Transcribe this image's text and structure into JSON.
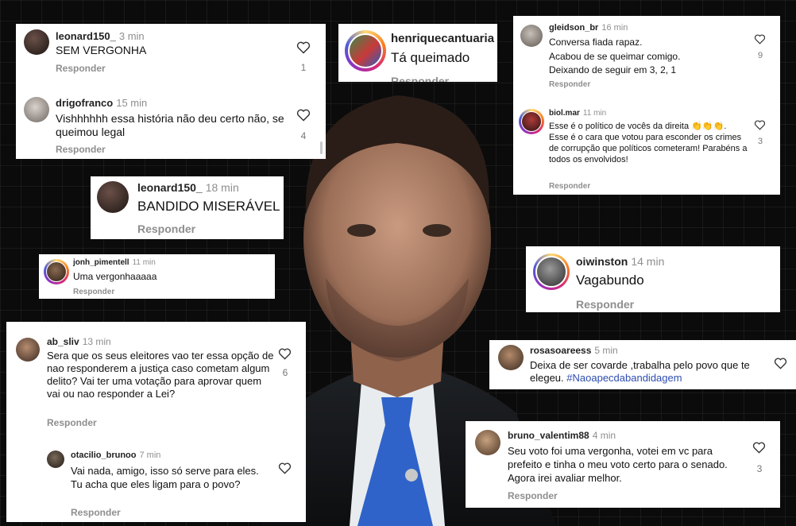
{
  "comments": {
    "c1": {
      "user": "leonard150_",
      "time": "3 min",
      "text": "SEM VERGONHA",
      "reply": "Responder",
      "likes": "1"
    },
    "c2": {
      "user": "drigofranco",
      "time": "15 min",
      "text": "Vishhhhhh essa história não deu certo não, se queimou legal",
      "reply": "Responder",
      "likes": "4"
    },
    "c3": {
      "user": "henriquecantuaria",
      "text": "Tá queimado",
      "reply": "Responder"
    },
    "c4": {
      "user": "gleidson_br",
      "time": "16 min",
      "lines": [
        "Conversa fiada rapaz.",
        "Acabou de se queimar comigo.",
        "Deixando de seguir em 3, 2, 1"
      ],
      "reply": "Responder",
      "likes": "9"
    },
    "c5": {
      "user": "biol.mar",
      "time": "11 min",
      "text": "Esse é o político de vocês da direita 👏👏👏. Esse é o cara que votou para esconder os crimes de corrupção que políticos cometeram! Parabéns a todos os envolvidos!",
      "reply": "Responder",
      "likes": "3"
    },
    "c6": {
      "user": "leonard150_",
      "time": "18 min",
      "text": "BANDIDO MISERÁVEL",
      "reply": "Responder"
    },
    "c7": {
      "user": "jonh_pimentell",
      "time": "11 min",
      "text": "Uma vergonhaaaaa",
      "reply": "Responder"
    },
    "c8": {
      "user": "oiwinston",
      "time": "14 min",
      "text": "Vagabundo",
      "reply": "Responder"
    },
    "c9": {
      "user": "ab_sliv",
      "time": "13 min",
      "text": "Sera que os seus eleitores vao ter essa opção de nao responderem a justiça caso cometam algum delito? Vai ter uma votação para aprovar quem vai ou nao responder a Lei?",
      "reply": "Responder",
      "likes": "6"
    },
    "c9r": {
      "user": "otacilio_brunoo",
      "time": "7 min",
      "text": "Vai nada, amigo, isso só serve para eles. Tu acha que eles ligam para o povo?",
      "reply": "Responder"
    },
    "c10": {
      "user": "rosasoareess",
      "time": "5 min",
      "text": "Deixa de ser covarde ,trabalha pelo povo que te elegeu.",
      "hashtag": "#Naoapecdabandidagem"
    },
    "c11": {
      "user": "bruno_valentim88",
      "time": "4 min",
      "text": "Seu voto foi uma vergonha, votei em vc para prefeito e tinha o meu voto certo para o senado. Agora irei avaliar melhor.",
      "reply": "Responder",
      "likes": "3"
    }
  },
  "icons": {
    "like": "heart-outline-icon",
    "avatar": "user-avatar"
  },
  "colors": {
    "background": "#0b0b0b",
    "card": "#ffffff",
    "meta": "#8e8e8e",
    "hashtag": "#2e4db0"
  }
}
